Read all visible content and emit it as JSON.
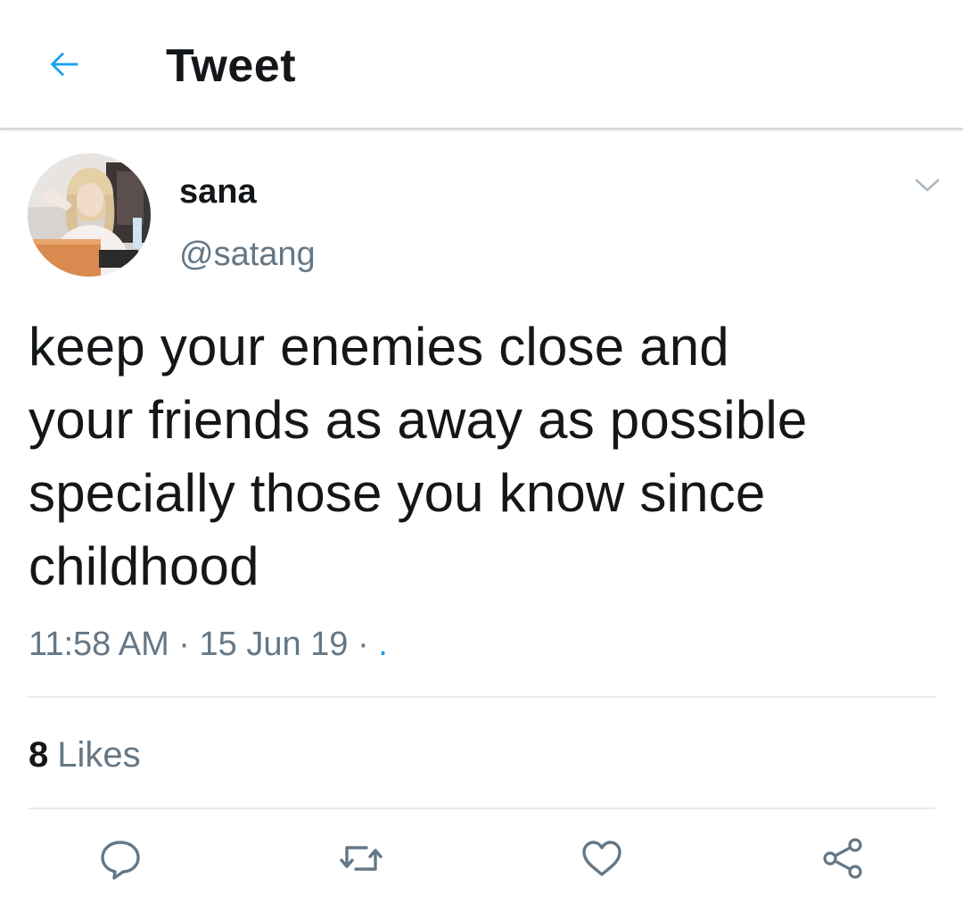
{
  "header": {
    "title": "Tweet",
    "back_icon": "arrow-left-icon"
  },
  "tweet": {
    "display_name": "sana",
    "handle": "@satang",
    "text": "keep your enemies close and\nyour friends as away as possible\nspecially those you know since\nchildhood",
    "time": "11:58 AM",
    "date": "15 Jun 19",
    "separator": "·",
    "source": ".",
    "likes_count": "8",
    "likes_label": "Likes"
  },
  "actions": [
    {
      "name": "reply",
      "icon": "reply-icon"
    },
    {
      "name": "retweet",
      "icon": "retweet-icon"
    },
    {
      "name": "like",
      "icon": "heart-icon"
    },
    {
      "name": "share",
      "icon": "share-icon"
    }
  ],
  "colors": {
    "accent": "#1da1f2",
    "text": "#14171a",
    "secondary": "#657786",
    "icon": "#657786",
    "divider": "#e6ecf0"
  }
}
